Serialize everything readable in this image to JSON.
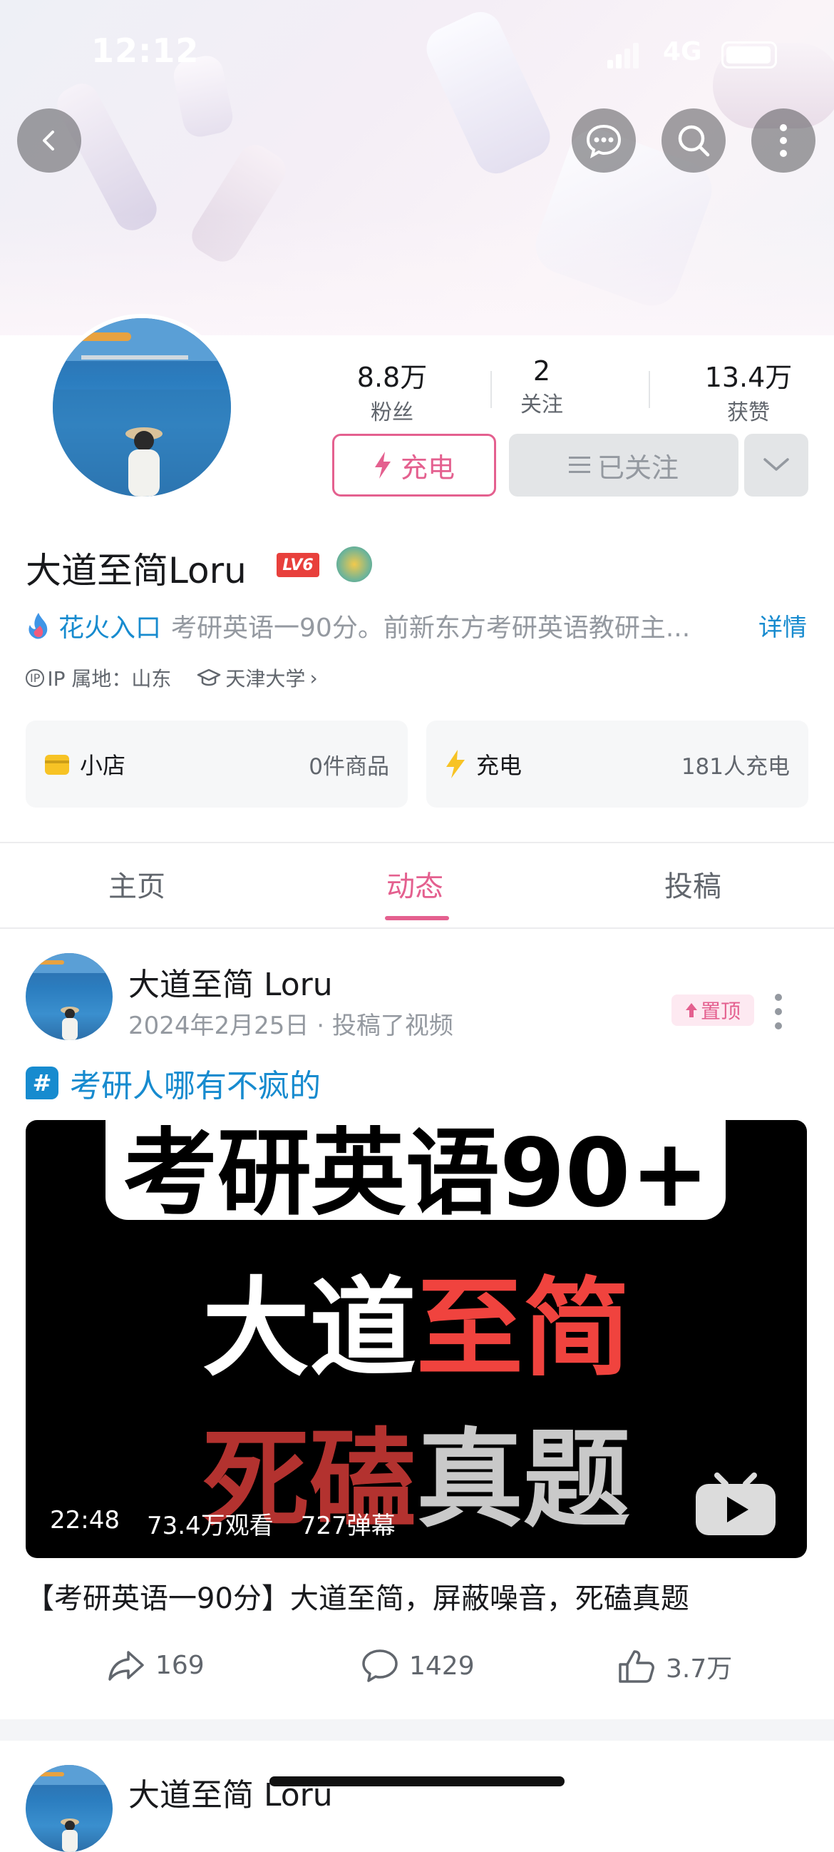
{
  "status_bar": {
    "time": "12:12",
    "network": "4G"
  },
  "profile": {
    "stats": [
      {
        "value": "8.8万",
        "label": "粉丝"
      },
      {
        "value": "2",
        "label": "关注"
      },
      {
        "value": "13.4万",
        "label": "获赞"
      }
    ],
    "charge_label": "充电",
    "follow_label": "已关注",
    "name": "大道至简Loru",
    "level_badge": "LV6",
    "spark_link": "花火入口",
    "bio": "考研英语一90分。前新东方考研英语教研主...",
    "bio_detail": "详情",
    "ip_tag": "IP",
    "ip_location": "IP 属地：山东",
    "school": "天津大学",
    "school_arrow": "›"
  },
  "cards": [
    {
      "title": "小店",
      "value": "0件商品",
      "icon": "shop-icon",
      "color": "#f7c325"
    },
    {
      "title": "充电",
      "value": "181人充电",
      "icon": "lightning-icon",
      "color": "#f7c325"
    }
  ],
  "tabs": [
    {
      "label": "主页",
      "active": false
    },
    {
      "label": "动态",
      "active": true
    },
    {
      "label": "投稿",
      "active": false
    }
  ],
  "post": {
    "author": "大道至简 Loru",
    "time_action": "2024年2月25日 · 投稿了视频",
    "pin_label": "置顶",
    "topic_symbol": "#",
    "topic": "考研人哪有不疯的",
    "cover": {
      "line1": "考研英语90+",
      "line2_a": "大道",
      "line2_b": "至简",
      "line3_a": "死磕",
      "line3_b": "真题"
    },
    "duration": "22:48",
    "views": "73.4万观看",
    "danmaku": "727弹幕",
    "title": "【考研英语一90分】大道至简，屏蔽噪音，死磕真题",
    "shares": "169",
    "comments": "1429",
    "likes": "3.7万"
  },
  "next_post": {
    "author": "大道至简 Loru"
  },
  "colors": {
    "accent": "#e4608f",
    "link": "#178bcf"
  }
}
